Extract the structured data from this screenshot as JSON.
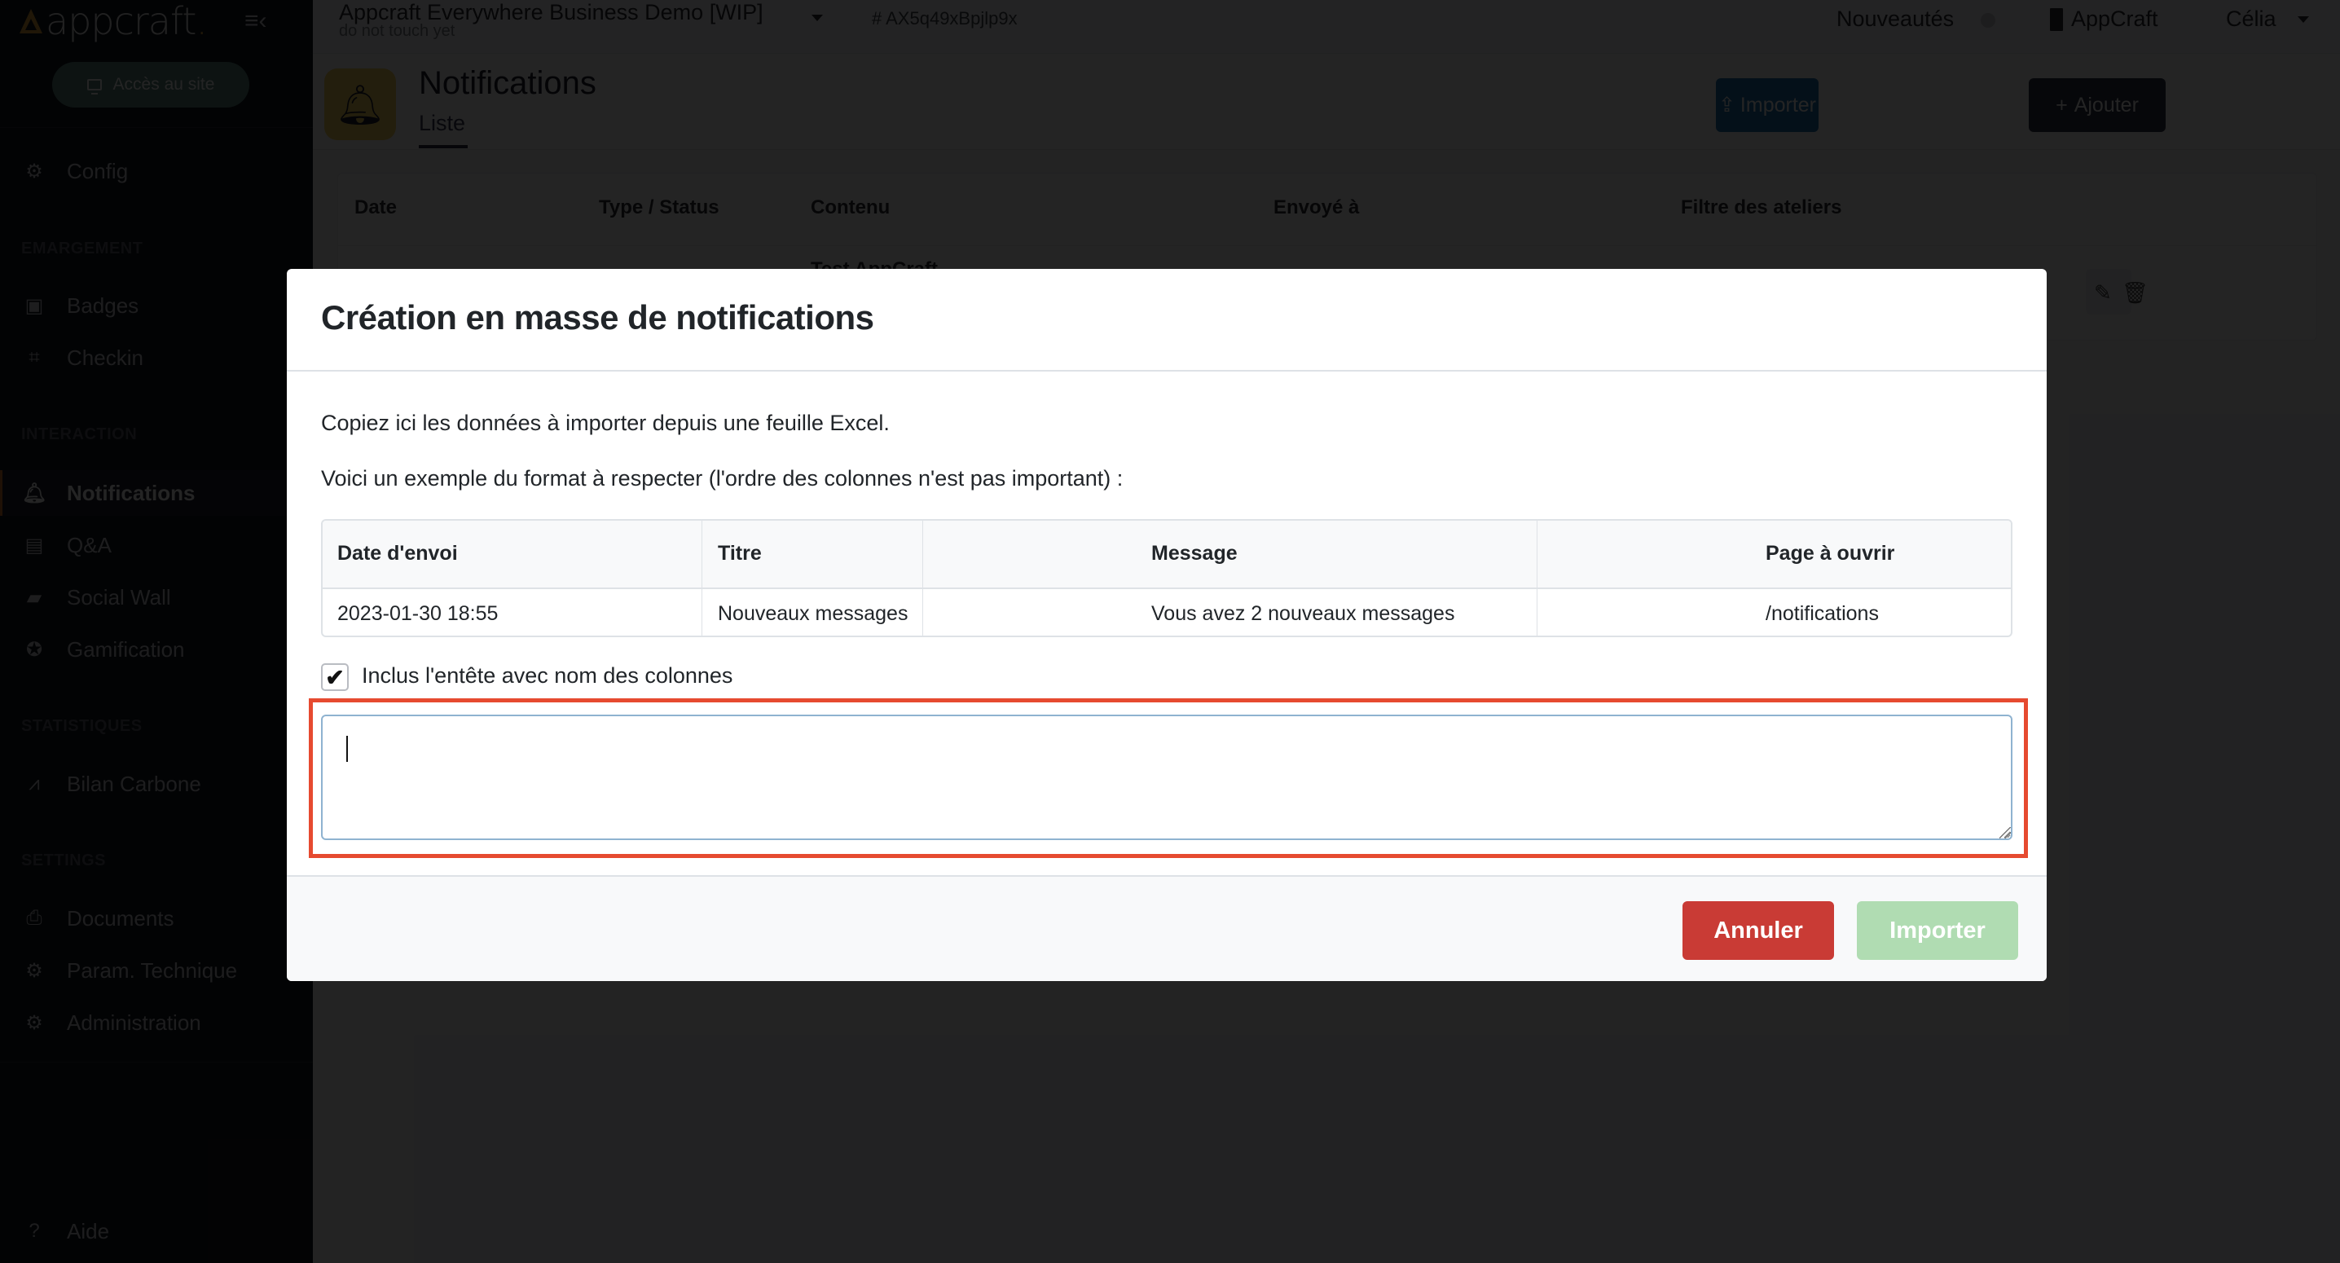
{
  "sidebar": {
    "logo_text": "appcraft",
    "logo_dot": ".",
    "site_button": "Accès au site",
    "items_top": [
      {
        "label": "Config",
        "icon": "gear-square-icon"
      }
    ],
    "sections": [
      {
        "title": "EMARGEMENT",
        "items": [
          {
            "label": "Badges",
            "icon": "id-badge-icon"
          },
          {
            "label": "Checkin",
            "icon": "qr-code-icon"
          }
        ]
      },
      {
        "title": "INTERACTION",
        "items": [
          {
            "label": "Notifications",
            "icon": "bell-icon",
            "active": true
          },
          {
            "label": "Q&A",
            "icon": "chat-icon"
          },
          {
            "label": "Social Wall",
            "icon": "image-message-icon"
          },
          {
            "label": "Gamification",
            "icon": "star-circle-icon"
          }
        ]
      },
      {
        "title": "STATISTIQUES",
        "items": [
          {
            "label": "Bilan Carbone",
            "icon": "chart-area-icon"
          }
        ]
      },
      {
        "title": "SETTINGS",
        "items": [
          {
            "label": "Documents",
            "icon": "printer-icon"
          },
          {
            "label": "Param. Technique",
            "icon": "gear-square-icon"
          },
          {
            "label": "Administration",
            "icon": "gear-icon"
          }
        ]
      }
    ],
    "help": {
      "label": "Aide",
      "icon": "question-circle-icon"
    }
  },
  "topbar": {
    "app_title": "Appcraft Everywhere Business Demo [WIP]",
    "app_subtitle": "do not touch yet",
    "app_id": "# AX5q49xBpjlp9x",
    "news": "Nouveautés",
    "org": "AppCraft",
    "user": "Célia"
  },
  "page": {
    "title": "Notifications",
    "tab": "Liste",
    "import_button": "Importer",
    "add_button": "Ajouter",
    "table_headers": [
      "Date",
      "Type / Status",
      "Contenu",
      "Envoyé à",
      "Filtre des ateliers"
    ],
    "row_partial_content": "Test AppCraft"
  },
  "modal": {
    "title": "Création en masse de notifications",
    "intro": "Copiez ici les données à importer depuis une feuille Excel.",
    "example_text": "Voici un exemple du format à respecter (l'ordre des colonnes n'est pas important) :",
    "example_table": {
      "headers": [
        "Date d'envoi",
        "Titre",
        "Message",
        "Page à ouvrir"
      ],
      "rows": [
        [
          "2023-01-30 18:55",
          "Nouveaux messages",
          "Vous avez 2 nouveaux messages",
          "/notifications"
        ]
      ]
    },
    "include_header_label": "Inclus l'entête avec nom des colonnes",
    "include_header_checked": true,
    "textarea_value": "",
    "cancel_button": "Annuler",
    "import_button": "Importer",
    "colors": {
      "cancel": "#c93b35",
      "import_disabled": "#b0dcb2",
      "highlight": "#e64a30"
    }
  }
}
